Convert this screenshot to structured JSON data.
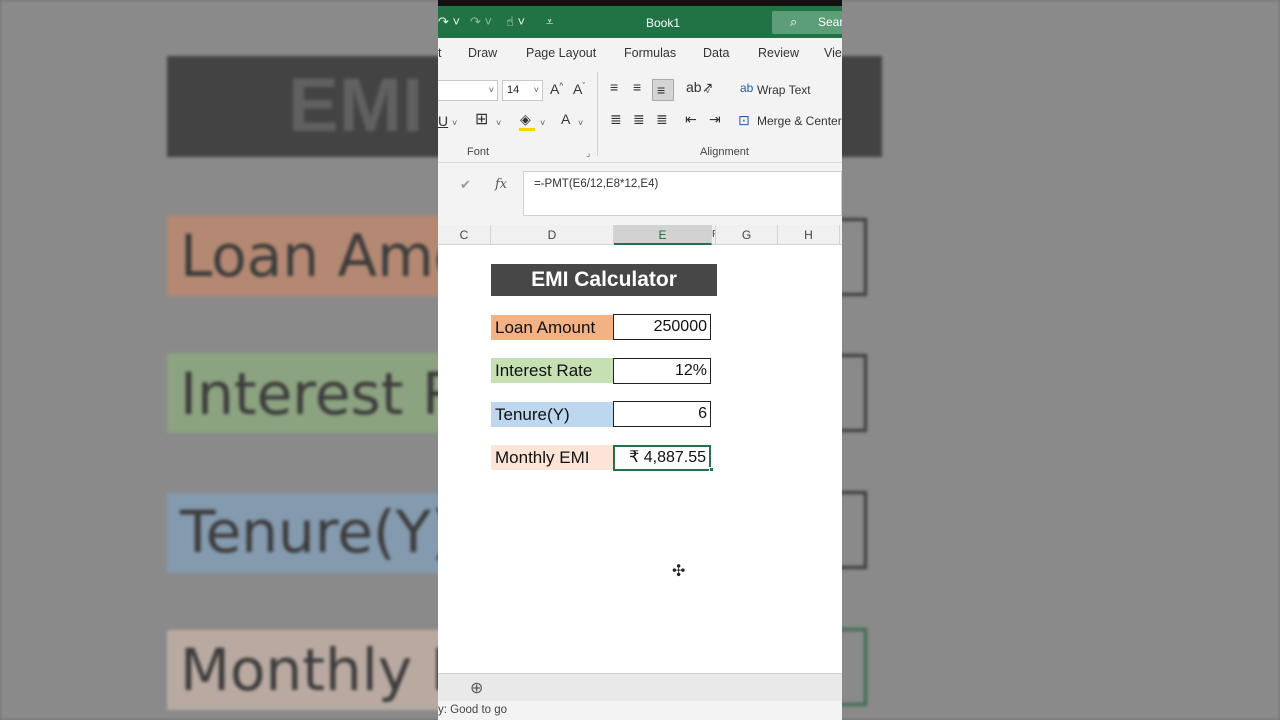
{
  "background": {
    "title_text": "EMI C",
    "labels": [
      "Loan Amo",
      "Interest Ra",
      "Tenure(Y)",
      "Monthly E"
    ],
    "colors": {
      "loan": "#f2a27a",
      "interest": "#a9d28f",
      "tenure": "#9cc3e6",
      "monthly": "#fad6c6",
      "title": "#474747"
    }
  },
  "titlebar": {
    "book_title": "Book1",
    "search_label": "Sear",
    "accent": "#217346"
  },
  "ribbon_tabs": [
    "Draw",
    "Page Layout",
    "Formulas",
    "Data",
    "Review",
    "Vie"
  ],
  "ribbon": {
    "font_size": "14",
    "wrap_text": "Wrap Text",
    "merge_center": "Merge & Center",
    "font_group": "Font",
    "alignment_group": "Alignment"
  },
  "formula_bar": {
    "fx": "fx",
    "formula": "=-PMT(E6/12,E8*12,E4)"
  },
  "columns": [
    "C",
    "D",
    "E",
    "F",
    "G",
    "H"
  ],
  "selected_column": "E",
  "sheet": {
    "title": "EMI Calculator",
    "rows": [
      {
        "label": "Loan Amount",
        "value": "250000",
        "color": "#f4b183"
      },
      {
        "label": "Interest Rate",
        "value": "12%",
        "color": "#c6e0b4"
      },
      {
        "label": "Tenure(Y)",
        "value": "6",
        "color": "#bdd7ee"
      },
      {
        "label": "Monthly EMI",
        "value": "₹ 4,887.55",
        "color": "#fce4d6"
      }
    ]
  },
  "status": {
    "text": "y: Good to go"
  }
}
